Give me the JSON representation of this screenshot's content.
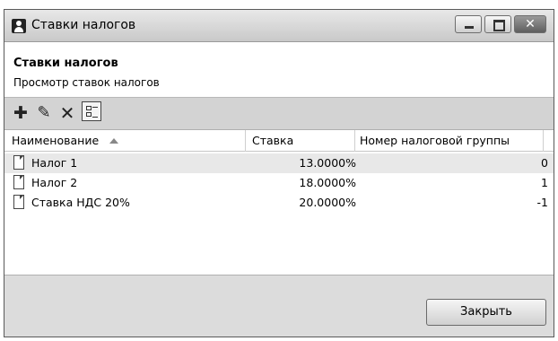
{
  "window": {
    "title": "Ставки налогов"
  },
  "header": {
    "title": "Ставки налогов",
    "subtitle": "Просмотр ставок налогов"
  },
  "toolbar": {
    "add_icon": "plus-icon",
    "edit_icon": "pencil-icon",
    "delete_icon": "cross-icon",
    "view_icon": "list-view-icon"
  },
  "table": {
    "columns": [
      "Наименование",
      "Ставка",
      "Номер налоговой группы"
    ],
    "sort_column": "Наименование",
    "sort_direction": "ascending",
    "rows": [
      {
        "name": "Налог 1",
        "rate": "13.0000%",
        "group": "0"
      },
      {
        "name": "Налог 2",
        "rate": "18.0000%",
        "group": "1"
      },
      {
        "name": "Ставка НДС 20%",
        "rate": "20.0000%",
        "group": "-1"
      }
    ]
  },
  "footer": {
    "close_label": "Закрыть"
  },
  "colors": {
    "selected_row": "#e8e8e8",
    "window_bg": "#dcdcdc"
  }
}
